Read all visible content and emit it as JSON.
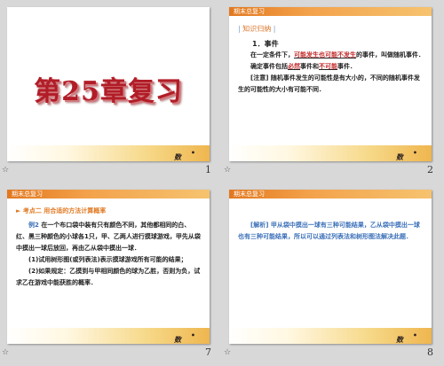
{
  "footer_brand": "数学",
  "slides": [
    {
      "number": "1",
      "title": "第25章复习"
    },
    {
      "number": "2",
      "header": "期末总复习",
      "section": "知识归纳",
      "item": "1．事件",
      "p1_pre": "在一定条件下，",
      "p1_fill": "可能发生也可能不发生",
      "p1_post": "的事件，叫做随机事件．",
      "p2_pre": "确定事件包括",
      "p2_fill1": "必然",
      "p2_mid": "事件和",
      "p2_fill2": "不可能",
      "p2_post": "事件．",
      "note": "[注意] 随机事件发生的可能性是有大小的，不同的随机事件发生的可能性的大小有可能不同．"
    },
    {
      "number": "7",
      "header": "期末总复习",
      "heading": "考点二 用合适的方法计算概率",
      "ex_label": "例2",
      "ex_body": "在一个布口袋中装有只有颜色不同，其他都相同的白、红、黑三种颜色的小球各1只，甲、乙两人进行摸球游戏，甲先从袋中摸出一球后放回，再由乙从袋中摸出一球．",
      "q1": "(1)试用树形图(或列表法)表示摸球游戏所有可能的结果；",
      "q2": "(2)如果规定：乙摸到与甲相同颜色的球为乙胜，否则为负，试求乙在游戏中能获胜的概率．"
    },
    {
      "number": "8",
      "header": "期末总复习",
      "analysis": "[解析] 甲从袋中摸出一球有三种可能结果，乙从袋中摸出一球也有三种可能结果，所以可以通过列表法和树形图法解决此题．"
    }
  ]
}
